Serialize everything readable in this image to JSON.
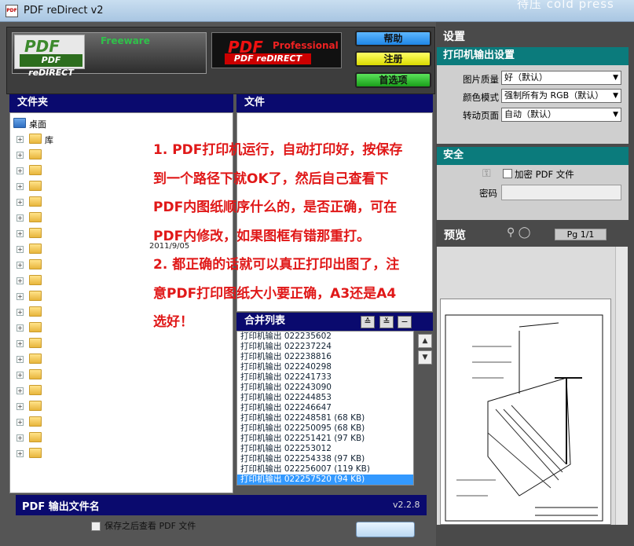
{
  "window": {
    "title": "PDF reDirect v2",
    "watermark": "待压  cold press"
  },
  "header": {
    "freeware_logo": "PDF reDIRECT",
    "freeware_label": "Freeware",
    "pro_logo": "PDF reDIRECT",
    "pro_label": "Professional",
    "help_button": "帮助",
    "register_button": "注册",
    "preferences_button": "首选项"
  },
  "folders": {
    "header": "文件夹",
    "items": [
      {
        "label": "桌面"
      },
      {
        "label": "库"
      },
      {
        "label": ""
      },
      {
        "label": ""
      },
      {
        "label": ""
      },
      {
        "label": ""
      },
      {
        "label": ""
      },
      {
        "label": ""
      },
      {
        "label": ""
      },
      {
        "label": ""
      },
      {
        "label": ""
      },
      {
        "label": ""
      },
      {
        "label": ""
      },
      {
        "label": ""
      },
      {
        "label": ""
      },
      {
        "label": ""
      },
      {
        "label": ""
      },
      {
        "label": ""
      },
      {
        "label": ""
      },
      {
        "label": ""
      },
      {
        "label": ""
      },
      {
        "label": ""
      }
    ],
    "date_fragment": "2011/9/05"
  },
  "files": {
    "header": "文件"
  },
  "annotation": {
    "lines": [
      "1. PDF打印机运行，自动打印好，按保存",
      "到一个路径下就OK了，然后自己查看下",
      "PDF内图纸顺序什么的，是否正确，可在",
      "PDF内修改，如果图框有错那重打。",
      "2. 都正确的话就可以真正打印出图了，注",
      "意PDF打印图纸大小要正确，A3还是A4",
      "选好！"
    ]
  },
  "merge_list": {
    "header": "合并列表",
    "items": [
      "打印机输出 022235602",
      "打印机输出 022237224",
      "打印机输出 022238816",
      "打印机输出 022240298",
      "打印机输出 022241733",
      "打印机输出 022243090",
      "打印机输出 022244853",
      "打印机输出 022246647",
      "打印机输出 022248581 (68 KB)",
      "打印机输出 022250095 (68 KB)",
      "打印机输出 022251421 (97 KB)",
      "打印机输出 022253012",
      "打印机输出 022254338 (97 KB)",
      "打印机输出 022256007 (119 KB)",
      "打印机输出 022257520 (94 KB)"
    ],
    "selected_index": 14
  },
  "output": {
    "title": "PDF 输出文件名",
    "version": "v2.2.8",
    "open_after": "保存之后查看 PDF 文件"
  },
  "settings": {
    "title": "设置",
    "printer_header": "打印机输出设置",
    "image_quality_label": "图片质量",
    "image_quality_value": "好（默认）",
    "color_mode_label": "颜色模式",
    "color_mode_value": "强制所有为 RGB（默认）",
    "rotate_label": "转动页面",
    "rotate_value": "自动（默认）"
  },
  "security": {
    "header": "安全",
    "encrypt_label": "加密 PDF 文件",
    "password_label": "密码"
  },
  "preview": {
    "title": "预览",
    "page_label": "Pg 1/1"
  },
  "colors": {
    "header_blue": "#0a0a6e",
    "teal": "#0b7b7c",
    "annotation_red": "#e01818"
  }
}
